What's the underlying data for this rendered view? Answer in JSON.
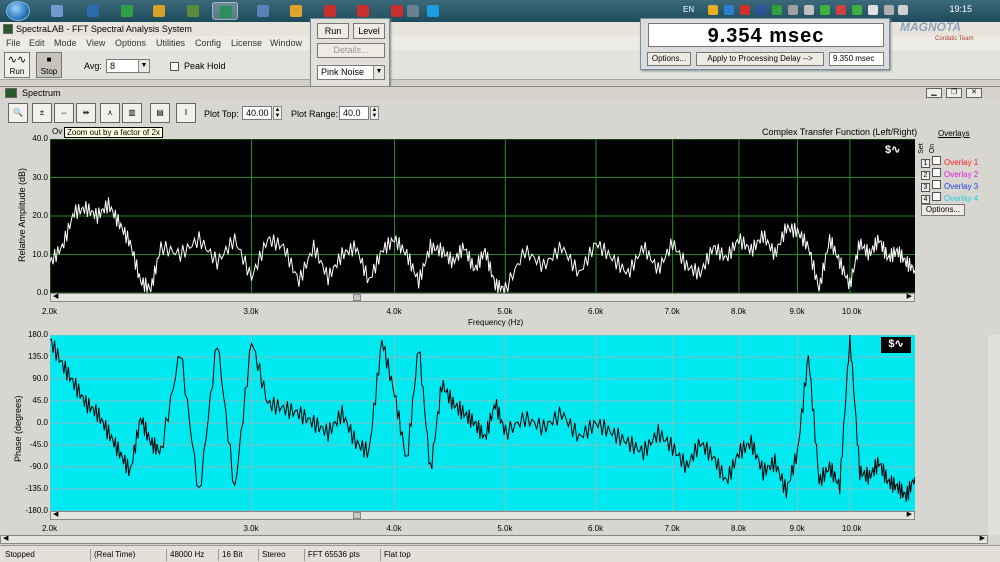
{
  "taskbar": {
    "lang": "EN",
    "clock": "19:15",
    "apps": [
      {
        "name": "app-1",
        "color": "#6f9acb",
        "active": false
      },
      {
        "name": "app-2",
        "color": "#2d6ab0",
        "active": false
      },
      {
        "name": "app-3",
        "color": "#2fa04a",
        "active": false
      },
      {
        "name": "app-4",
        "color": "#d9a227",
        "active": false
      },
      {
        "name": "app-5",
        "color": "#5a8a3c",
        "active": false
      },
      {
        "name": "app-6",
        "color": "#2c8e5a",
        "active": true
      },
      {
        "name": "app-7",
        "color": "#5d7fb8",
        "active": false
      },
      {
        "name": "app-8",
        "color": "#e0a22a",
        "active": false
      },
      {
        "name": "app-9",
        "color": "#c83030",
        "active": false
      },
      {
        "name": "app-10",
        "color": "#c83030",
        "active": false
      },
      {
        "name": "app-11",
        "color": "#c83030",
        "active": false
      },
      {
        "name": "app-12",
        "color": "#6b7f90",
        "active": false
      },
      {
        "name": "app-13",
        "color": "#1e9de0",
        "active": false
      }
    ]
  },
  "app": {
    "title": "SpectraLAB - FFT Spectral Analysis System",
    "menu": [
      "File",
      "Edit",
      "Mode",
      "View",
      "Options",
      "Utilities",
      "Config",
      "License",
      "Window"
    ],
    "toolbar": {
      "run_label": "Run",
      "stop_label": "Stop",
      "avg_label": "Avg:",
      "avg_value": "8",
      "peak_hold_label": "Peak Hold"
    }
  },
  "run_panel": {
    "run_label": "Run",
    "level_label": "Level",
    "details_label": "Details...",
    "noise_value": "Pink Noise"
  },
  "delay_panel": {
    "readout": "9.354 msec",
    "options_label": "Options...",
    "apply_label": "Apply to Processing Delay -->",
    "apply_value": "9.350 msec"
  },
  "watermark": {
    "text": "MAGNOTA",
    "team": "Cordatic Team"
  },
  "spectrum": {
    "title": "Spectrum",
    "plot_top_label": "Plot Top:",
    "plot_top_value": "40.00",
    "plot_range_label": "Plot Range:",
    "plot_range_value": "40.0",
    "tooltip": "Zoom out by a factor of 2x",
    "tf_label": "Complex Transfer Function (Left/Right)",
    "overlays_header": "Overlays",
    "set_label": "Set",
    "on_label": "On",
    "overlays": [
      {
        "num": "1",
        "label": "Overlay 1",
        "color": "#ff2020"
      },
      {
        "num": "2",
        "label": "Overlay 2",
        "color": "#e020e0"
      },
      {
        "num": "3",
        "label": "Overlay 3",
        "color": "#2040e0"
      },
      {
        "num": "4",
        "label": "Overlay 4",
        "color": "#20d0e0"
      }
    ],
    "options_label": "Options...",
    "xlabel": "Frequency (Hz)"
  },
  "chart_data": [
    {
      "type": "line",
      "title": "Complex Transfer Function (Left/Right)",
      "ylabel": "Relative Amplitude (dB)",
      "xlabel": "Frequency (Hz)",
      "yticks": [
        "40.0",
        "30.0",
        "20.0",
        "10.0",
        "0.0"
      ],
      "xticks": [
        "2.0k",
        "3.0k",
        "4.0k",
        "5.0k",
        "6.0k",
        "7.0k",
        "8.0k",
        "9.0k",
        "10.0k"
      ],
      "xscale": "log",
      "xlim": [
        2000,
        11400
      ],
      "ylim": [
        0,
        40
      ],
      "background": "#000000",
      "line_color": "#ffffff",
      "grid_color": "#1f8a1f",
      "series": [
        {
          "x": [
            2000,
            2050,
            2100,
            2150,
            2200,
            2250,
            2300,
            2350,
            2400,
            2450,
            2500,
            2600,
            2700,
            2800,
            2900,
            3000,
            3100,
            3200,
            3300,
            3400,
            3500,
            3600,
            3700,
            3800,
            3900,
            4000,
            4100,
            4200,
            4300,
            4400,
            4500,
            4600,
            4700,
            4800,
            4900,
            5000,
            5200,
            5400,
            5600,
            5800,
            6000,
            6200,
            6400,
            6600,
            6800,
            7000,
            7200,
            7400,
            7600,
            7800,
            8000,
            8200,
            8400,
            8600,
            8800,
            9000,
            9200,
            9400,
            9600,
            9800,
            10000,
            10200,
            10400,
            10600,
            10800,
            11000,
            11200,
            11400
          ],
          "y": [
            8,
            12,
            21,
            22,
            20,
            23,
            18,
            13,
            3,
            1,
            12,
            10,
            14,
            8,
            14,
            4,
            14,
            12,
            3,
            12,
            4,
            10,
            12,
            3,
            11,
            14,
            10,
            3,
            12,
            11,
            8,
            12,
            6,
            11,
            2,
            1,
            11,
            7,
            12,
            5,
            13,
            9,
            5,
            12,
            6,
            13,
            7,
            5,
            12,
            9,
            14,
            11,
            15,
            10,
            17,
            16,
            12,
            1,
            14,
            8,
            2,
            13,
            10,
            14,
            9,
            11,
            8,
            6
          ]
        }
      ]
    },
    {
      "type": "line",
      "ylabel": "Phase (degrees)",
      "xlabel": "Frequency (Hz)",
      "yticks": [
        "180.0",
        "135.0",
        "90.0",
        "45.0",
        "0.0",
        "-45.0",
        "-90.0",
        "-135.0",
        "-180.0"
      ],
      "xticks": [
        "2.0k",
        "3.0k",
        "4.0k",
        "5.0k",
        "6.0k",
        "7.0k",
        "8.0k",
        "9.0k",
        "10.0k"
      ],
      "xscale": "log",
      "xlim": [
        2000,
        11400
      ],
      "ylim": [
        -180,
        180
      ],
      "background": "#00e8f0",
      "line_color": "#000000",
      "grid_color": "#80c0c8",
      "series": [
        {
          "x": [
            2000,
            2050,
            2100,
            2150,
            2200,
            2250,
            2300,
            2350,
            2400,
            2450,
            2500,
            2600,
            2700,
            2800,
            2900,
            3000,
            3100,
            3200,
            3300,
            3400,
            3500,
            3600,
            3700,
            3800,
            3900,
            4000,
            4100,
            4200,
            4300,
            4400,
            4500,
            4600,
            4700,
            4800,
            4900,
            5000,
            5200,
            5400,
            5600,
            5800,
            6000,
            6200,
            6400,
            6600,
            6800,
            7000,
            7200,
            7400,
            7600,
            7800,
            8000,
            8200,
            8400,
            8600,
            8800,
            9000,
            9200,
            9400,
            9600,
            9800,
            10000,
            10200,
            10400,
            10600,
            10800,
            11000,
            11200,
            11400
          ],
          "y": [
            170,
            120,
            80,
            40,
            20,
            -20,
            -60,
            -100,
            10,
            -40,
            -60,
            150,
            -150,
            170,
            -140,
            170,
            40,
            30,
            20,
            0,
            -20,
            20,
            -40,
            -60,
            170,
            60,
            -80,
            160,
            -100,
            80,
            40,
            20,
            0,
            -30,
            40,
            -20,
            10,
            -10,
            20,
            -30,
            0,
            -20,
            -40,
            -60,
            -20,
            -50,
            -90,
            -40,
            -70,
            -120,
            -60,
            -40,
            -100,
            -80,
            -140,
            -60,
            140,
            -120,
            -90,
            -130,
            180,
            -100,
            -110,
            -80,
            -120,
            -130,
            -150,
            -110
          ]
        }
      ]
    }
  ],
  "status": {
    "state": "Stopped",
    "mode": "(Real Time)",
    "rate": "48000 Hz",
    "bits": "16 Bit",
    "channels": "Stereo",
    "fft": "FFT 65536 pts",
    "window": "Flat top"
  }
}
